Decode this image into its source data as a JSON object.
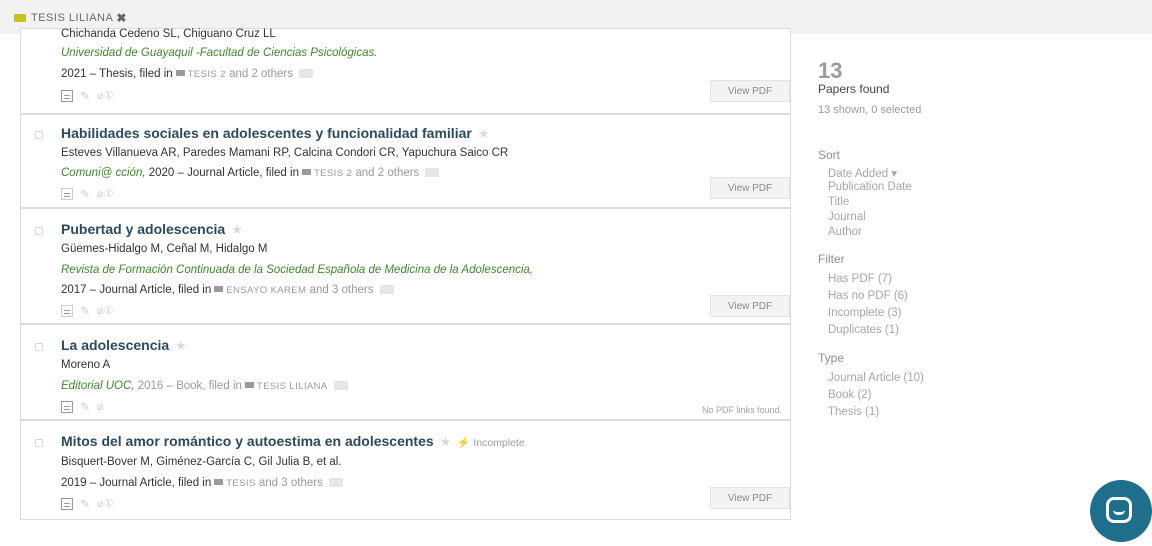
{
  "tag_filter": {
    "label": "TESIS LILIANA",
    "remove": "✖"
  },
  "papers": [
    {
      "authors": "Chichanda Cedeno SL, Chiguano Cruz LL",
      "venue": "Universidad de Guayaquil -Facultad de Ciencias Psicológicas.",
      "meta_prefix": "2021 – Thesis, filed in",
      "folder": "TESIS 2",
      "folder_suffix": "and 2 others",
      "pdf": "View PDF"
    },
    {
      "title": "Habilidades sociales en adolescentes y funcionalidad familiar",
      "authors": "Esteves Villanueva AR, Paredes Mamani RP, Calcina Condori CR, Yapuchura Saico CR",
      "venue": "Comuni@ cción,",
      "venue_rest": " 2020 – Journal Article, filed in",
      "folder": "TESIS 2",
      "folder_suffix": "and 2 others",
      "pdf": "View PDF"
    },
    {
      "title": "Pubertad y adolescencia",
      "authors": "Güemes-Hidalgo M, Ceñal M, Hidalgo M",
      "venue": "Revista de Formación Continuada de la Sociedad Española de Medicina de la Adolescencia,",
      "meta_prefix": "2017 – Journal Article, filed in",
      "folder": "ENSAYO KAREM",
      "folder_suffix": "and 3 others",
      "pdf": "View PDF"
    },
    {
      "title": "La adolescencia",
      "authors": "Moreno A",
      "venue": "Editorial UOC,",
      "venue_rest": " 2016 – Book, filed in",
      "folder": "TESIS LILIANA",
      "nopdf": "No PDF links found."
    },
    {
      "title": "Mitos del amor romántico y autoestima en adolescentes",
      "incomplete": "Incomplete",
      "authors": "Bisquert-Bover M, Giménez-García C, Gil Julia B, et al.",
      "meta_prefix": "2019 – Journal Article, filed in",
      "folder": "TESIS",
      "folder_suffix": "and 3 others",
      "pdf": "View PDF"
    }
  ],
  "summary": {
    "count": "13",
    "found": "Papers found",
    "shown": "13 shown, 0 selected"
  },
  "sort": {
    "heading": "Sort",
    "options": [
      "Date Added ▾",
      "Publication Date",
      "Title",
      "Journal",
      "Author"
    ]
  },
  "filter": {
    "heading": "Filter",
    "options": [
      "Has PDF (7)",
      "Has no PDF (6)",
      "Incomplete (3)",
      "Duplicates (1)"
    ]
  },
  "type": {
    "heading": "Type",
    "options": [
      "Journal Article (10)",
      "Book (2)",
      "Thesis (1)"
    ]
  },
  "colors": {
    "accent": "#1f6e8c",
    "venue_green": "#3b8a2a",
    "title": "#2a4a5e",
    "folder": "#c7c325"
  }
}
